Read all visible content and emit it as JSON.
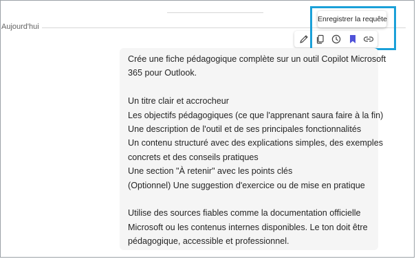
{
  "conversation": {
    "day_label": "Aujourd'hui"
  },
  "toolbar": {
    "tooltip": "Enregistrer la requête",
    "buttons": [
      {
        "icon": "pencil-icon"
      },
      {
        "icon": "copy-icon"
      },
      {
        "icon": "history-icon"
      },
      {
        "icon": "bookmark-icon"
      },
      {
        "icon": "link-icon"
      }
    ],
    "accent_color": "#4f52d8",
    "highlight_color": "#1aa0d8"
  },
  "message": {
    "intro": [
      "Crée une fiche pédagogique complète sur un outil Copilot Microsoft",
      "365 pour Outlook."
    ],
    "items": [
      "Un titre clair et accrocheur",
      "Les objectifs pédagogiques (ce que l'apprenant saura faire à la fin)",
      "Une description de l'outil et de ses principales fonctionnalités",
      "Un contenu structuré avec des explications simples, des exemples",
      "concrets et des conseils pratiques",
      "Une section \"À retenir\" avec les points clés",
      "(Optionnel) Une suggestion d'exercice ou de mise en pratique"
    ],
    "outro": [
      "Utilise des sources fiables comme la documentation officielle",
      "Microsoft ou les contenus internes disponibles. Le ton doit être",
      "pédagogique, accessible et professionnel."
    ]
  }
}
